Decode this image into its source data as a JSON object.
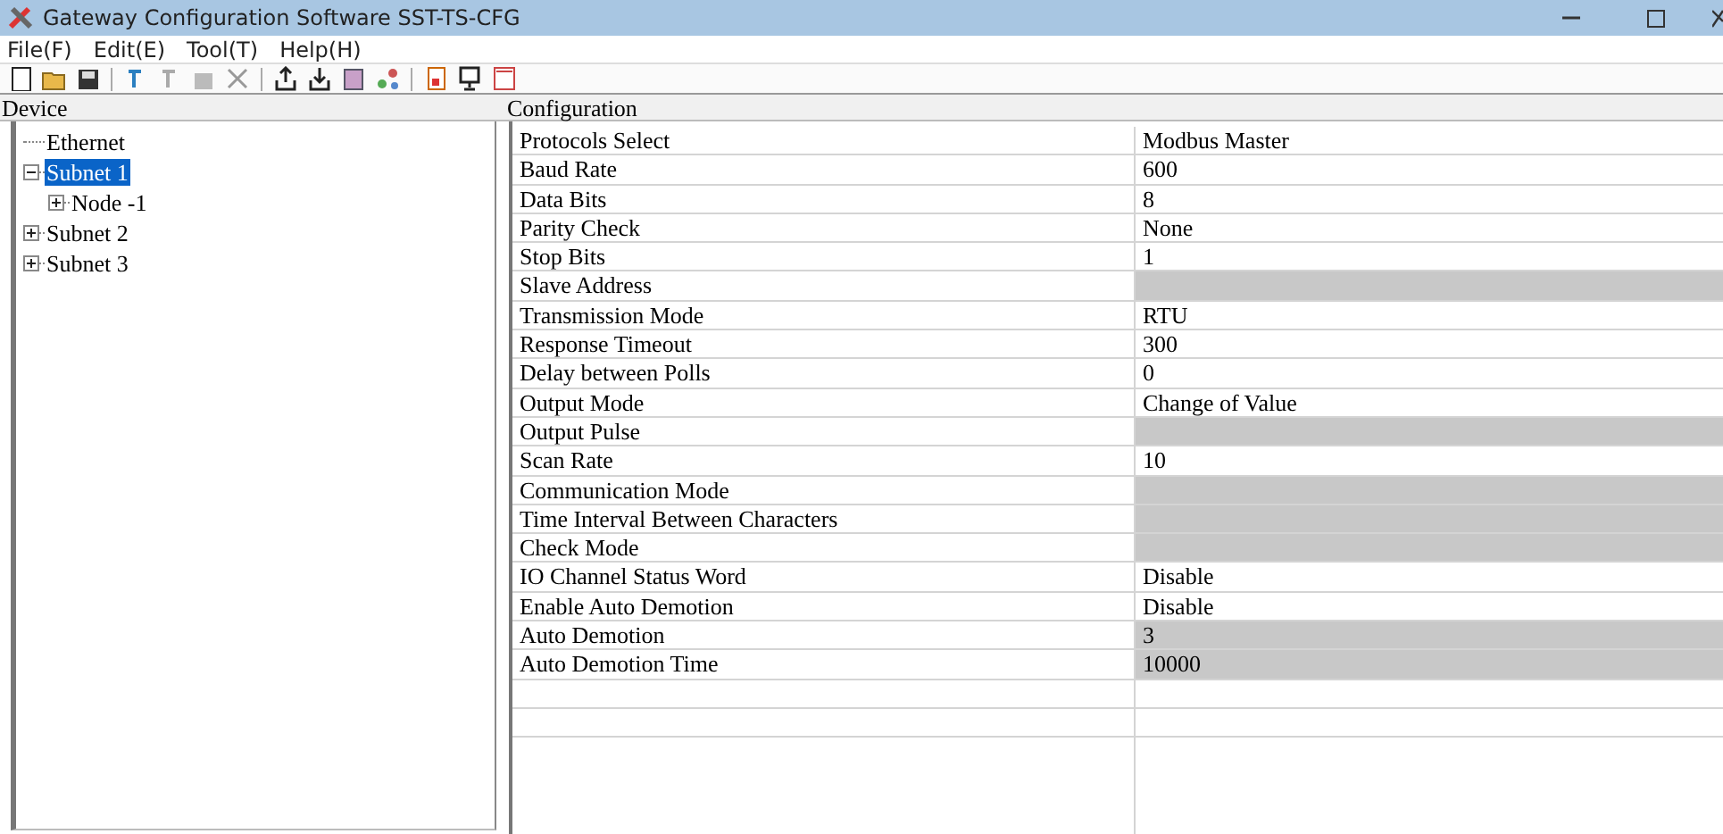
{
  "window": {
    "title": "Gateway Configuration Software SST-TS-CFG"
  },
  "menu": [
    "File(F)",
    "Edit(E)",
    "Tool(T)",
    "Help(H)"
  ],
  "device_panel": {
    "title": "Device",
    "tree": [
      {
        "label": "Ethernet",
        "selected": false
      },
      {
        "label": "Subnet 1",
        "selected": true,
        "expanded": true,
        "children": [
          {
            "label": "Node -1",
            "selected": false,
            "expanded": false
          }
        ]
      },
      {
        "label": "Subnet 2",
        "selected": false,
        "expanded": false
      },
      {
        "label": "Subnet 3",
        "selected": false,
        "expanded": false
      }
    ]
  },
  "configuration": {
    "title": "Configuration",
    "rows": [
      {
        "name": "Protocols Select",
        "value": "Modbus Master",
        "disabled": false
      },
      {
        "name": "Baud Rate",
        "value": "600",
        "disabled": false
      },
      {
        "name": "Data Bits",
        "value": "8",
        "disabled": false
      },
      {
        "name": "Parity Check",
        "value": "None",
        "disabled": false
      },
      {
        "name": "Stop Bits",
        "value": "1",
        "disabled": false
      },
      {
        "name": "Slave Address",
        "disabled": true
      },
      {
        "name": "Transmission Mode",
        "value": "RTU",
        "disabled": false
      },
      {
        "name": "Response Timeout",
        "value": "300",
        "disabled": false
      },
      {
        "name": "Delay between Polls",
        "value": "0",
        "disabled": false
      },
      {
        "name": "Output Mode",
        "value": "Change of Value",
        "disabled": false
      },
      {
        "name": "Output Pulse",
        "disabled": true
      },
      {
        "name": "Scan Rate",
        "value": "10",
        "disabled": false
      },
      {
        "name": "Communication Mode",
        "disabled": true
      },
      {
        "name": "Time Interval Between Characters",
        "disabled": true
      },
      {
        "name": "Check Mode",
        "disabled": true
      },
      {
        "name": "IO Channel Status Word",
        "value": "Disable",
        "disabled": false
      },
      {
        "name": "Enable Auto Demotion",
        "value": "Disable",
        "disabled": false
      },
      {
        "name": "Auto Demotion",
        "value": "3",
        "disabled": true
      },
      {
        "name": "Auto Demotion Time",
        "value": "10000",
        "disabled": true
      }
    ]
  }
}
